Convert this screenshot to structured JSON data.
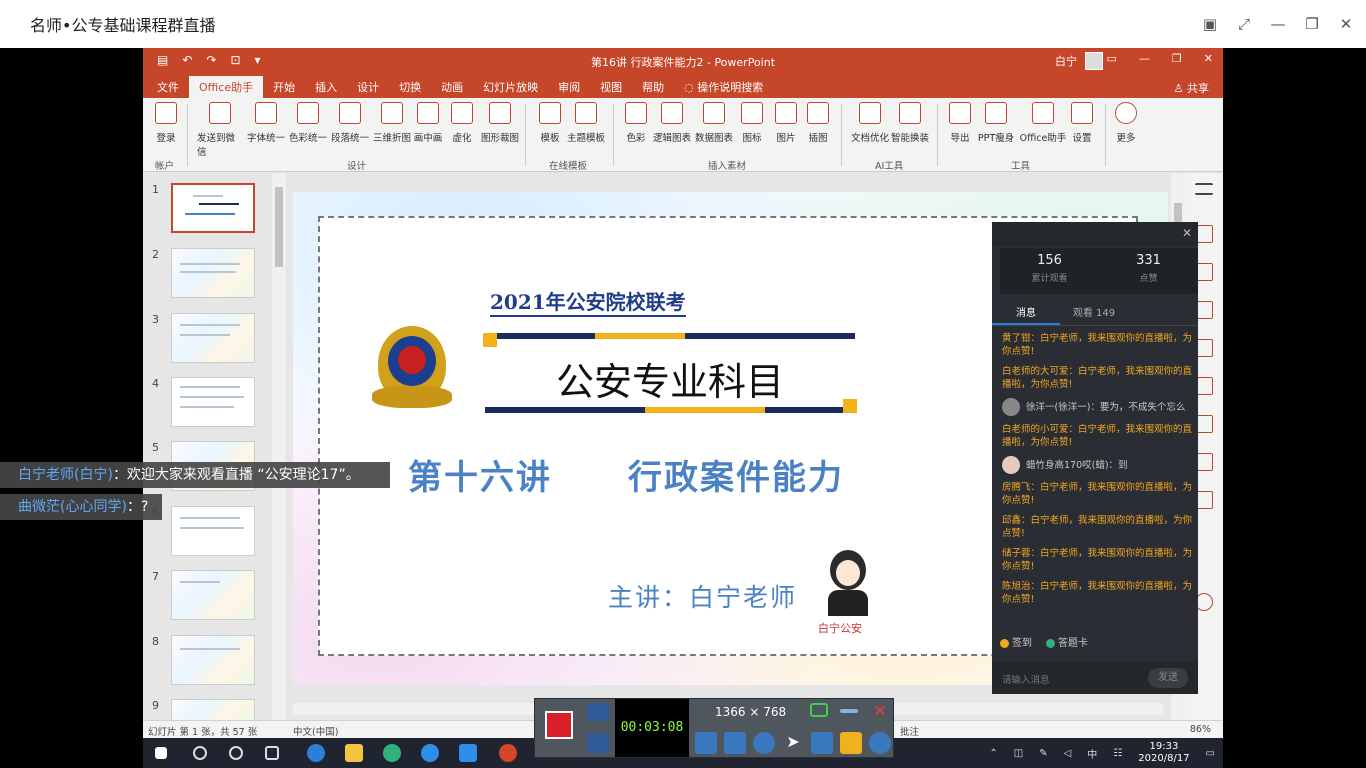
{
  "app": {
    "title": "名师•公专基础课程群直播"
  },
  "ppt": {
    "doc_title": "第16讲 行政案件能力2  -  PowerPoint",
    "user": "白宁",
    "share": "共享",
    "tabs": [
      "文件",
      "Office助手",
      "开始",
      "插入",
      "设计",
      "切换",
      "动画",
      "幻灯片放映",
      "审阅",
      "视图",
      "帮助",
      "操作说明搜索"
    ],
    "ribbon_items": [
      {
        "label": "登录",
        "left": 0
      },
      {
        "label": "发送到微信"
      },
      {
        "label": "字体统一"
      },
      {
        "label": "色彩统一"
      },
      {
        "label": "段落统一"
      },
      {
        "label": "三维折图"
      },
      {
        "label": "画中画"
      },
      {
        "label": "虚化"
      },
      {
        "label": "图形裁图"
      },
      {
        "label": "模板"
      },
      {
        "label": "主题模板"
      },
      {
        "label": "色彩"
      },
      {
        "label": "逻辑图表"
      },
      {
        "label": "数据图表"
      },
      {
        "label": "图标"
      },
      {
        "label": "图片"
      },
      {
        "label": "插图"
      },
      {
        "label": "文档优化"
      },
      {
        "label": "智能换装"
      },
      {
        "label": "导出"
      },
      {
        "label": "PPT瘦身"
      },
      {
        "label": "Office助手"
      },
      {
        "label": "设置"
      },
      {
        "label": "更多"
      }
    ],
    "ribbon_groups": [
      "帐户",
      "设计",
      "在线模板",
      "插入素材",
      "AI工具",
      "工具"
    ],
    "thumb_numbers": [
      "1",
      "2",
      "3",
      "4",
      "5",
      "6",
      "7",
      "8",
      "9"
    ],
    "status": {
      "slide_info": "幻灯片 第 1 张，共 57 张",
      "lang": "中文(中国)",
      "notes": "批注",
      "zoom": "86%"
    }
  },
  "slide": {
    "subtitle": "2021年公安院校联考",
    "main_title": "公安专业科目",
    "lesson": "第十六讲",
    "lesson_name": "行政案件能力",
    "presenter": "主讲：白宁老师",
    "logo_label": "白宁公安"
  },
  "live": {
    "views": "156",
    "views_label": "累计观看",
    "likes": "331",
    "likes_label": "点赞",
    "tab_messages": "消息",
    "tab_viewers": "观看 149",
    "messages": [
      {
        "text": "黄了钳：白宁老师，我来围观你的直播啦，为你点赞!",
        "type": "sys"
      },
      {
        "text": "白老师的大可爱：白宁老师，我来围观你的直播啦，为你点赞!",
        "type": "sys"
      },
      {
        "text": "徐洋一(徐洋一)：要为，不成失个忘么",
        "type": "user"
      },
      {
        "text": "白老师的小可爱：白宁老师，我来围观你的直播啦，为你点赞!",
        "type": "sys"
      },
      {
        "text": "蜡竹身高170哎(蜡)：到",
        "type": "user"
      },
      {
        "text": "房腾飞：白宁老师，我来围观你的直播啦，为你点赞!",
        "type": "sys"
      },
      {
        "text": "邱鑫：白宁老师，我来围观你的直播啦，为你点赞!",
        "type": "sys"
      },
      {
        "text": "储子蓉：白宁老师，我来围观你的直播啦，为你点赞!",
        "type": "sys"
      },
      {
        "text": "陈旭治：白宁老师，我来围观你的直播啦，为你点赞!",
        "type": "sys"
      }
    ],
    "signin": "签到",
    "answer_card": "答题卡",
    "input_placeholder": "请输入消息",
    "send": "发送"
  },
  "danmu": [
    {
      "name": "白宁老师(白宁)",
      "text": "：欢迎大家来观看直播 “公安理论17”。"
    },
    {
      "name": "曲微茫(心心同学)",
      "text": "：?"
    }
  ],
  "recorder": {
    "time": "00:03:08",
    "resolution": "1366 × 768"
  },
  "taskbar": {
    "time": "19:33",
    "date": "2020/8/17",
    "ime": "中"
  },
  "colors": {
    "ppt_accent": "#c6462a",
    "slide_blue": "#4b82c6",
    "live_bg": "#2a2d33",
    "msg_orange": "#f1a722"
  }
}
